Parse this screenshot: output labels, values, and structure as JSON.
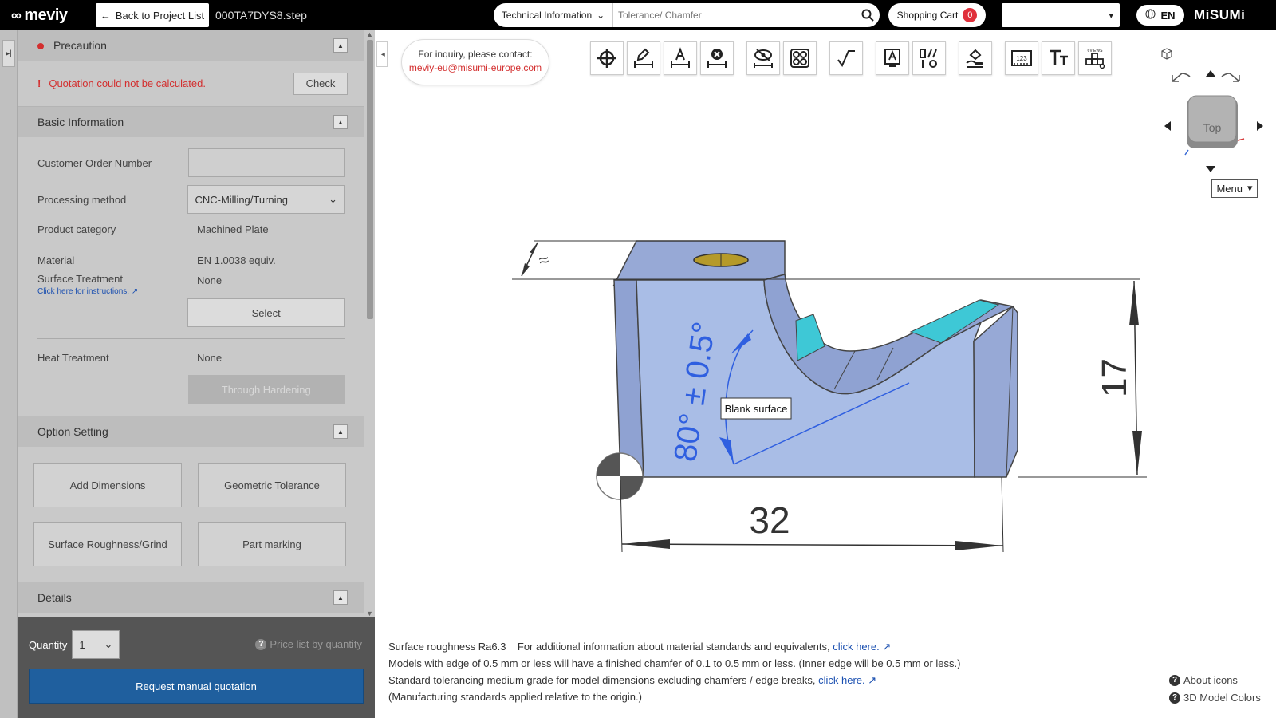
{
  "topbar": {
    "logo": "meviy",
    "back_label": "Back to Project List",
    "filename": "000TA7DYS8.step",
    "search_category": "Technical Information",
    "search_placeholder": "Tolerance/ Chamfer",
    "cart_label": "Shopping Cart",
    "cart_count": "0",
    "language": "EN",
    "brand": "MiSUMi"
  },
  "precaution": {
    "title": "Precaution",
    "message": "Quotation could not be calculated.",
    "check_label": "Check"
  },
  "basic_info": {
    "title": "Basic Information",
    "customer_order_label": "Customer Order Number",
    "customer_order_value": "",
    "processing_label": "Processing method",
    "processing_value": "CNC-Milling/Turning",
    "category_label": "Product category",
    "category_value": "Machined Plate",
    "material_label": "Material",
    "material_value": "EN 1.0038 equiv.",
    "surface_label": "Surface Treatment",
    "surface_value": "None",
    "instructions_link": "Click here for instructions.",
    "select_label": "Select",
    "heat_label": "Heat Treatment",
    "heat_value": "None",
    "through_hardening_label": "Through Hardening"
  },
  "option_setting": {
    "title": "Option Setting",
    "buttons": [
      "Add Dimensions",
      "Geometric Tolerance",
      "Surface Roughness/Grind",
      "Part marking"
    ]
  },
  "details": {
    "title": "Details"
  },
  "order": {
    "quantity_label": "Quantity",
    "quantity_value": "1",
    "price_list_link": "Price list by quantity",
    "request_label": "Request manual quotation"
  },
  "inquiry": {
    "line1": "For inquiry, please contact:",
    "email": "meviy-eu@misumi-europe.com"
  },
  "navcube": {
    "face": "Top",
    "menu_label": "Menu"
  },
  "model": {
    "tooltip": "Blank surface",
    "dim_width": "32",
    "dim_height": "17",
    "dim_angle": "80° ± 0.5°",
    "dim_depth": "≈"
  },
  "notes": {
    "roughness": "Surface roughness Ra6.3",
    "material_info": "For additional information about material standards and equivalents,",
    "click_here_1": "click here.",
    "chamfer_note": "Models with edge of 0.5 mm or less will have a finished chamfer of 0.1 to 0.5 mm or less. (Inner edge will be 0.5 mm or less.)",
    "tolerance_note": "Standard tolerancing medium grade for model dimensions excluding chamfers / edge breaks,",
    "click_here_2": "click here.",
    "origin_note": "(Manufacturing standards applied relative to the origin.)"
  },
  "help": {
    "about_icons": "About icons",
    "model_colors": "3D Model Colors"
  },
  "colors": {
    "accent_blue": "#1f5f9e",
    "warning_red": "#d32f2f",
    "model_face": "#a9bde6",
    "model_highlight": "#3ec8d6"
  }
}
